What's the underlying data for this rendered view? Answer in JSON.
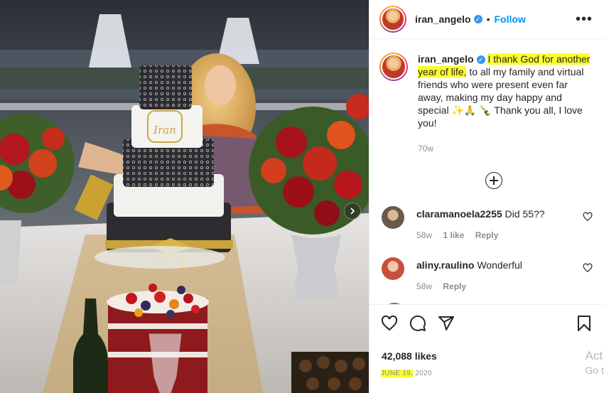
{
  "post": {
    "username": "iran_angelo",
    "follow_label": "Follow",
    "more_label": "•••",
    "caption_highlight": "I thank God for another year of life,",
    "caption_rest": " to all my family and virtual friends who were present even far away, making my day happy and special ✨🙏 🍾 Thank you all, I love you!",
    "age": "70w",
    "likes": "42,088 likes",
    "date_highlight": "JUNE 19,",
    "date_rest": " 2020"
  },
  "comments": [
    {
      "username": "claramanoela2255",
      "text": "Did 55??",
      "age": "58w",
      "likes": "1 like",
      "reply": "Reply",
      "avatar_color": "#6b5a4a"
    },
    {
      "username": "aliny.raulino",
      "text": "Wonderful",
      "age": "58w",
      "likes": "",
      "reply": "Reply",
      "avatar_color": "#c94f3f"
    }
  ],
  "photo": {
    "cake_text": "Iran"
  },
  "watermark": {
    "line1": "Act",
    "line2": "Go t"
  },
  "colors": {
    "follow": "#0095f6",
    "highlight": "#fbff2e",
    "verified": "#3897f0"
  },
  "icons": [
    "heart-icon",
    "comment-icon",
    "share-icon",
    "bookmark-icon",
    "chevron-right-icon",
    "plus-circle-icon",
    "verified-icon"
  ]
}
